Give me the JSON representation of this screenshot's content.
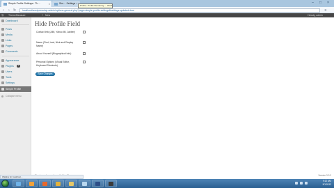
{
  "browser": {
    "active_tab_title": "Simple Profile Settings ‹ Th…",
    "inactive_tab_title": "Sim… Settings ‹ …",
    "url": "localhost/wordpress/wp-admin/options-general.php?page=simple-profile-settings&settings-updated=true",
    "tooltip": "Profile › Profile Rendering — WordPress",
    "window_controls": [
      "–",
      "□",
      "×"
    ]
  },
  "admin_bar": {
    "site_name": "ThemeMeasure",
    "items": [
      "+",
      "New"
    ],
    "greeting": "Howdy, admin"
  },
  "sidebar": {
    "items": [
      {
        "label": "Dashboard",
        "icon": "dashboard-icon"
      },
      {
        "label": "Posts",
        "icon": "posts-icon"
      },
      {
        "label": "Media",
        "icon": "media-icon"
      },
      {
        "label": "Links",
        "icon": "links-icon"
      },
      {
        "label": "Pages",
        "icon": "pages-icon"
      },
      {
        "label": "Comments",
        "icon": "comments-icon"
      },
      {
        "label": "Appearance",
        "icon": "appearance-icon"
      },
      {
        "label": "Plugins",
        "icon": "plugins-icon",
        "badge": "1"
      },
      {
        "label": "Users",
        "icon": "users-icon"
      },
      {
        "label": "Tools",
        "icon": "tools-icon"
      },
      {
        "label": "Settings",
        "icon": "settings-icon"
      },
      {
        "label": "Simple Profile",
        "icon": "profile-icon",
        "current": true
      }
    ],
    "collapse_label": "Collapse menu"
  },
  "main": {
    "title": "Hide Profile Field",
    "fields": [
      {
        "label": "Contact Info (AIM, Yahoo IM, Jabber)",
        "checked": false
      },
      {
        "label": "Name (First, Last, Nick and Display Name)",
        "checked": false
      },
      {
        "label": "About Yourself (Biographical Info)",
        "checked": false
      },
      {
        "label": "Personal Options (Visual Editor, Keyboard Shortcuts)",
        "checked": false
      }
    ],
    "save_label": "Save Changes"
  },
  "footer": {
    "left": "Thank you for creating with WordPress.",
    "right": "Version 3.3.2"
  },
  "status_bar": "Waiting for localhost...",
  "taskbar": {
    "apps": [
      "explorer-icon",
      "media-player-icon",
      "firefox-icon",
      "chrome-icon",
      "explorer-folder-icon",
      "notepad-icon",
      "photoshop-icon",
      "terminal-icon"
    ],
    "time": "9:12 AM",
    "date": "5/1/2012"
  },
  "colors": {
    "accent": "#21759b",
    "admin_bar": "#464646",
    "button": "#2a7eb3",
    "current_menu": "#777777"
  }
}
